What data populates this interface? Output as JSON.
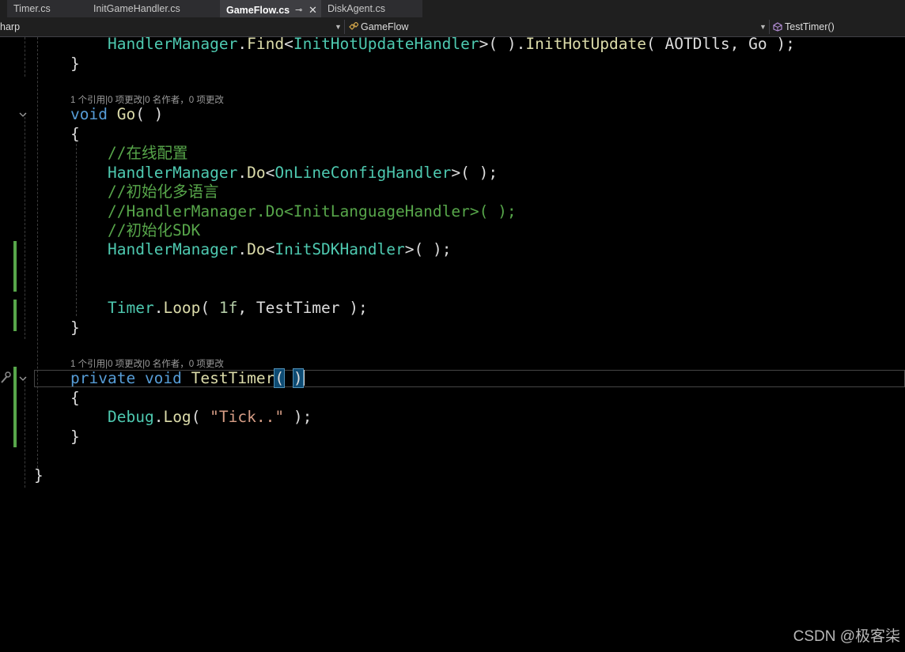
{
  "tabs": [
    {
      "label": "Timer.cs",
      "active": false
    },
    {
      "label": "InitGameHandler.cs",
      "active": false
    },
    {
      "label": "GameFlow.cs",
      "active": true
    },
    {
      "label": "DiskAgent.cs",
      "active": false
    }
  ],
  "active_tab_pin": "⊸",
  "active_tab_close": "✕",
  "nav": {
    "project": "harp",
    "type": "GameFlow",
    "member": "TestTimer()"
  },
  "code_lens": {
    "go": "1 个引用|0 项更改|0 名作者，0 项更改",
    "test_timer": "1 个引用|0 项更改|0 名作者，0 项更改"
  },
  "code": {
    "l1_type": "HandlerManager",
    "l1_p1": ".",
    "l1_method": "Find",
    "l1_p2": "<",
    "l1_generic": "InitHotUpdateHandler",
    "l1_p3": ">( ).",
    "l1_method2": "InitHotUpdate",
    "l1_p4": "( AOTDlls, Go );",
    "l2": "}",
    "go_kw": "void",
    "go_name": "Go",
    "go_rest": "( )",
    "open1": "{",
    "c1": "//在线配置",
    "l_online_type": "HandlerManager",
    "l_online_p1": ".",
    "l_online_method": "Do",
    "l_online_p2": "<",
    "l_online_generic": "OnLineConfigHandler",
    "l_online_p3": ">( );",
    "c2": "//初始化多语言",
    "c3": "//HandlerManager.Do<InitLanguageHandler>( );",
    "c4": "//初始化SDK",
    "l_sdk_type": "HandlerManager",
    "l_sdk_p1": ".",
    "l_sdk_method": "Do",
    "l_sdk_p2": "<",
    "l_sdk_generic": "InitSDKHandler",
    "l_sdk_p3": ">( );",
    "l_timer_type": "Timer",
    "l_timer_p1": ".",
    "l_timer_method": "Loop",
    "l_timer_p2": "( ",
    "l_timer_num": "1f",
    "l_timer_p3": ", TestTimer );",
    "close1": "}",
    "tt_kw1": "private",
    "tt_kw2": "void",
    "tt_name": "TestTimer",
    "tt_paren_open": "(",
    "tt_space": " ",
    "tt_paren_close": ")",
    "open2": "{",
    "dbg_type": "Debug",
    "dbg_p1": ".",
    "dbg_method": "Log",
    "dbg_p2": "( ",
    "dbg_str": "\"Tick..\"",
    "dbg_p3": " );",
    "close2": "}",
    "close_class": "}"
  },
  "watermark": "CSDN @极客柒",
  "colors": {
    "keyword": "#569cd6",
    "type": "#4ec9b0",
    "method": "#dcdcaa",
    "comment": "#57a64a",
    "string": "#d69d85",
    "change_bar": "#57a64a"
  }
}
